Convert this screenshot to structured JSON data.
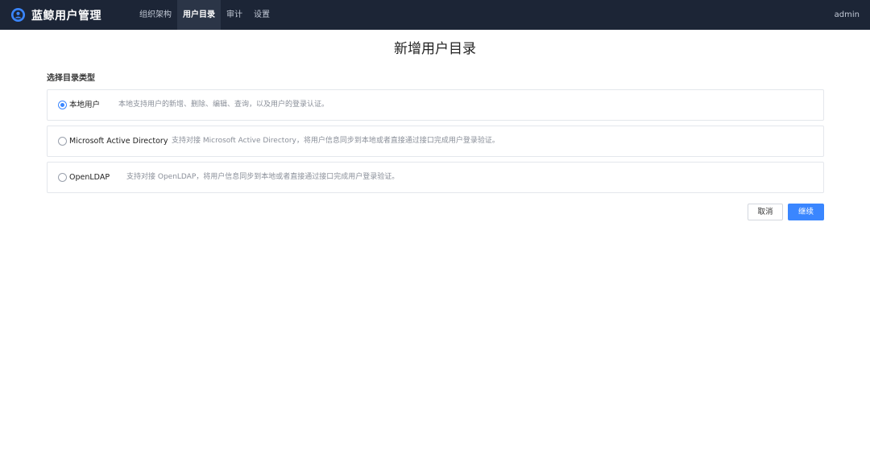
{
  "brand": {
    "name": "蓝鲸用户管理",
    "icon": "user-circle-icon"
  },
  "nav": {
    "items": [
      {
        "label": "组织架构",
        "active": false
      },
      {
        "label": "用户目录",
        "active": true
      },
      {
        "label": "审计",
        "active": false
      },
      {
        "label": "设置",
        "active": false
      }
    ]
  },
  "user": {
    "name": "admin"
  },
  "page": {
    "title": "新增用户目录"
  },
  "form": {
    "section_label": "选择目录类型",
    "options": [
      {
        "label": "本地用户",
        "description": "本地支持用户的新增、删除、编辑、查询，以及用户的登录认证。",
        "selected": true
      },
      {
        "label": "Microsoft Active Directory",
        "description": "支持对接 Microsoft Active Directory，将用户信息同步到本地或者直接通过接口完成用户登录验证。",
        "selected": false
      },
      {
        "label": "OpenLDAP",
        "description": "支持对接 OpenLDAP，将用户信息同步到本地或者直接通过接口完成用户登录验证。",
        "selected": false
      }
    ]
  },
  "buttons": {
    "cancel": "取消",
    "continue": "继续"
  },
  "colors": {
    "topbar": "#1c2536",
    "accent": "#3a86ff"
  }
}
